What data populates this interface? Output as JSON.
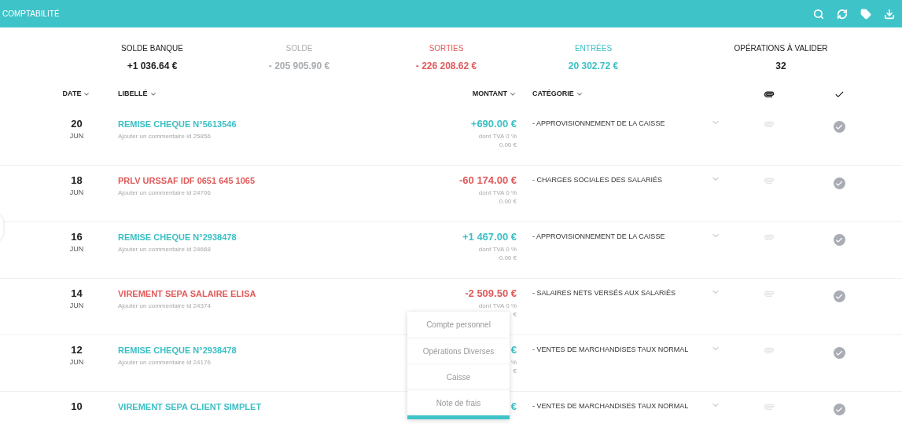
{
  "app_bar": {
    "title": "COMPTABILITÉ"
  },
  "stats": [
    {
      "label": "SOLDE BANQUE",
      "value": "+1 036.64 €",
      "color": "#222222"
    },
    {
      "label": "SOLDE",
      "value": "- 205 905.90 €",
      "color": "#a9adb0"
    },
    {
      "label": "SORTIES",
      "value": "- 226 208.62 €",
      "color": "#e05a5a"
    },
    {
      "label": "ENTRÉES",
      "value": "20 302.72 €",
      "color": "#3bbfc4"
    },
    {
      "label": "OPÉRATIONS À VALIDER",
      "value": "32",
      "color": "#222222"
    }
  ],
  "table": {
    "columns": [
      "DATE",
      "LIBELLÉ",
      "MONTANT",
      "CATÉGORIE"
    ],
    "rows": [
      {
        "day": "20",
        "month": "JUN",
        "label": "REMISE CHEQUE N°5613546",
        "kind": "credit",
        "comment": "Ajouter un commentaire id 25856",
        "amount": "+690.00 €",
        "tva": "dont TVA 0 %",
        "tva_amount": "0.00 €",
        "category": "- APPROVISIONNEMENT DE LA CAISSE",
        "attached": false,
        "validated": true
      },
      {
        "day": "18",
        "month": "JUN",
        "label": "PRLV URSSAF IDF 0651 645 1065",
        "kind": "debit",
        "comment": "Ajouter un commentaire id 24706",
        "amount": "-60 174.00 €",
        "tva": "dont TVA 0 %",
        "tva_amount": "0.00 €",
        "category": "- CHARGES SOCIALES DES SALARIÉS",
        "attached": false,
        "validated": true
      },
      {
        "day": "16",
        "month": "JUN",
        "label": "REMISE CHEQUE N°2938478",
        "kind": "credit",
        "comment": "Ajouter un commentaire id 24668",
        "amount": "+1 467.00 €",
        "tva": "dont TVA 0 %",
        "tva_amount": "0.00 €",
        "category": "- APPROVISIONNEMENT DE LA CAISSE",
        "attached": false,
        "validated": true
      },
      {
        "day": "14",
        "month": "JUN",
        "label": "VIREMENT SEPA SALAIRE ELISA",
        "kind": "debit",
        "comment": "Ajouter un commentaire id 24374",
        "amount": "-2 509.50 €",
        "tva": "dont TVA 0 %",
        "tva_amount": "€",
        "category": "- SALAIRES NETS VERSÉS AUX SALARIÉS",
        "attached": false,
        "validated": true
      },
      {
        "day": "12",
        "month": "JUN",
        "label": "REMISE CHEQUE N°2938478",
        "kind": "credit",
        "comment": "Ajouter un commentaire id 24176",
        "amount": "€",
        "tva": "%",
        "tva_amount": "€",
        "category": "- VENTES DE MARCHANDISES TAUX NORMAL",
        "attached": false,
        "validated": true
      },
      {
        "day": "10",
        "label": "VIREMENT SEPA CLIENT SIMPLET",
        "kind": "credit",
        "amount": "€",
        "category": "- VENTES DE MARCHANDISES TAUX NORMAL",
        "attached": false,
        "validated": true
      }
    ]
  },
  "menu": {
    "items": [
      "Compte personnel",
      "Opérations Diverses",
      "Caisse",
      "Note de frais"
    ]
  }
}
